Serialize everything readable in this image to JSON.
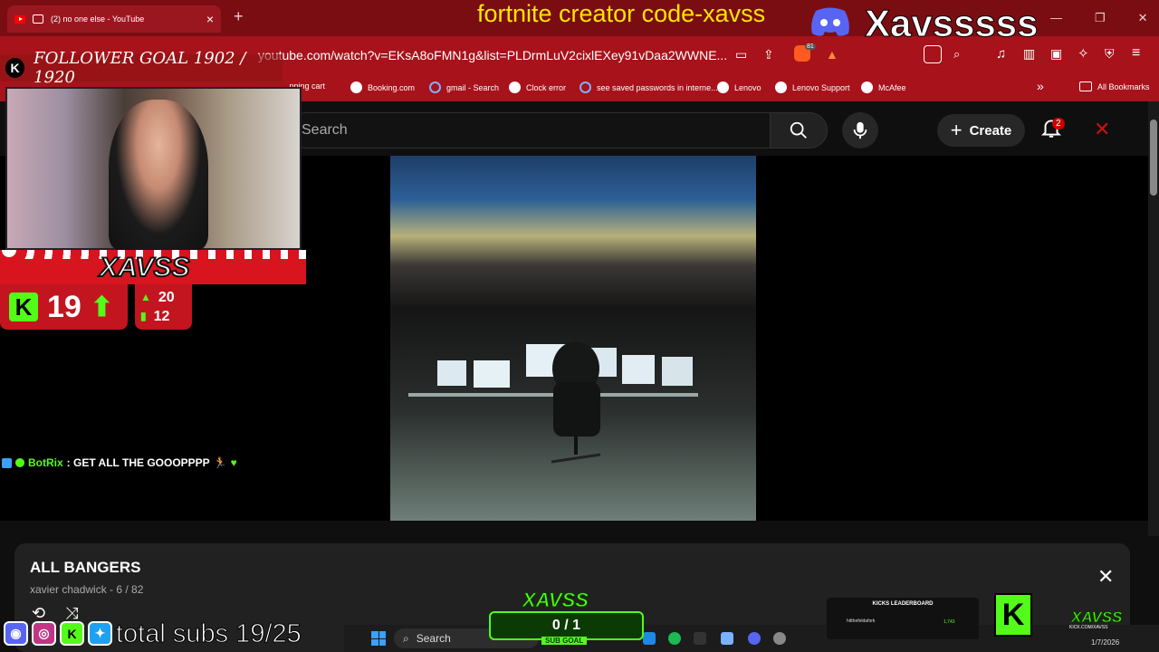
{
  "browser": {
    "tab_title": "(2) no one else - YouTube",
    "url": "youtube.com/watch?v=EKsA8oFMN1g&list=PLDrmLuV2cixlEXey91vDaa2WWNE...",
    "all_bookmarks": "All Bookmarks",
    "bookmarks": [
      "...pping cart",
      "Booking.com",
      "gmail - Search",
      "Clock error",
      "see saved passwords in interne...",
      "Lenovo",
      "Lenovo Support",
      "McAfee"
    ],
    "brave_badge": "81"
  },
  "youtube": {
    "search_placeholder": "Search",
    "create_label": "Create",
    "notification_count": "2"
  },
  "playlist": {
    "title": "ALL BANGERS",
    "subtitle": "xavier chadwick - 6 / 82"
  },
  "overlay": {
    "title": "fortnite creator code-xavss",
    "brand": "Xavsssss",
    "follower_goal": "FOLLOWER GOAL 1902 / 1920",
    "streamer_name": "XAVSS",
    "kick_followers": "19",
    "stat_top": "20",
    "stat_bottom": "12",
    "chat_user": "BotRix",
    "chat_message": ": GET ALL THE GOOOPPPP",
    "total_subs": "total subs 19/25",
    "subgoal_title": "XAVSS",
    "subgoal_value": "0 / 1",
    "subgoal_label": "SUB GOAL",
    "leaderboard_title": "KICKS LEADERBOARD",
    "leaderboard_entry": "hitthefeldafork",
    "leaderboard_value": "1,743",
    "kick_name": "XAVSS",
    "kick_url": "KICK.COM/XAVSS"
  },
  "taskbar": {
    "search_label": "Search",
    "date": "1/7/2026"
  },
  "colors": {
    "chrome": "#a8121b",
    "kick_green": "#53fc18",
    "youtube_bg": "#0f0f0f"
  }
}
